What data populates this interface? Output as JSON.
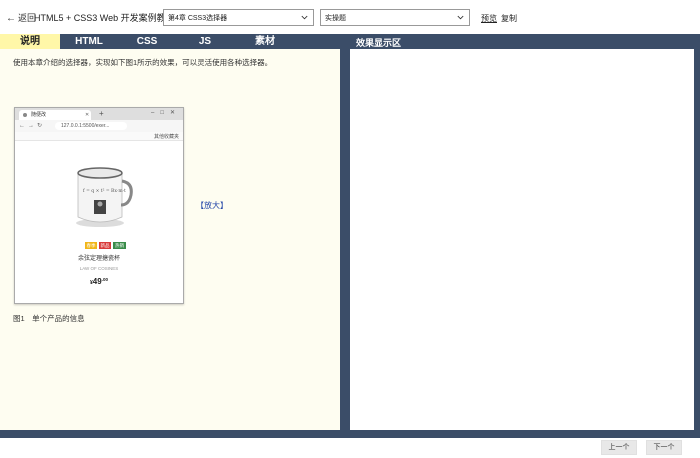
{
  "topbar": {
    "back_label": "返回",
    "course_title": "HTML5 + CSS3 Web 开发案例教程",
    "chapter_select": "第4章 CSS3选择器",
    "type_select": "实操题",
    "preview_label": "预览",
    "copy_label": "复制"
  },
  "tabs": [
    {
      "label": "说明"
    },
    {
      "label": "HTML"
    },
    {
      "label": "CSS"
    },
    {
      "label": "JS"
    },
    {
      "label": "素材"
    }
  ],
  "left": {
    "intro": "使用本章介绍的选择器，实现如下图1所示的效果，可以灵活使用各种选择器。",
    "enlarge": "【放大】",
    "caption": "图1　单个产品的信息"
  },
  "screenshot": {
    "tab_title": "随便改",
    "url": "127.0.0.1:5500/exer...",
    "bookmark_right": "其他收藏夹",
    "mug_text": "f = q × t² = Bx·m·t",
    "badges": [
      "春季",
      "新品",
      "热销"
    ],
    "product_name": "余弦定理搪瓷杯",
    "product_sub": "LAW OF COSINES",
    "price_currency": "¥",
    "price_int": "49",
    "price_cents": ".00"
  },
  "right": {
    "title": "效果显示区"
  },
  "footer": {
    "prev_label": "上一个",
    "next_label": "下一个"
  },
  "colors": {
    "dark": "#3b4d68",
    "active_tab": "#fff7a8",
    "left_bg": "#fefdf1",
    "link": "#2547a8"
  }
}
